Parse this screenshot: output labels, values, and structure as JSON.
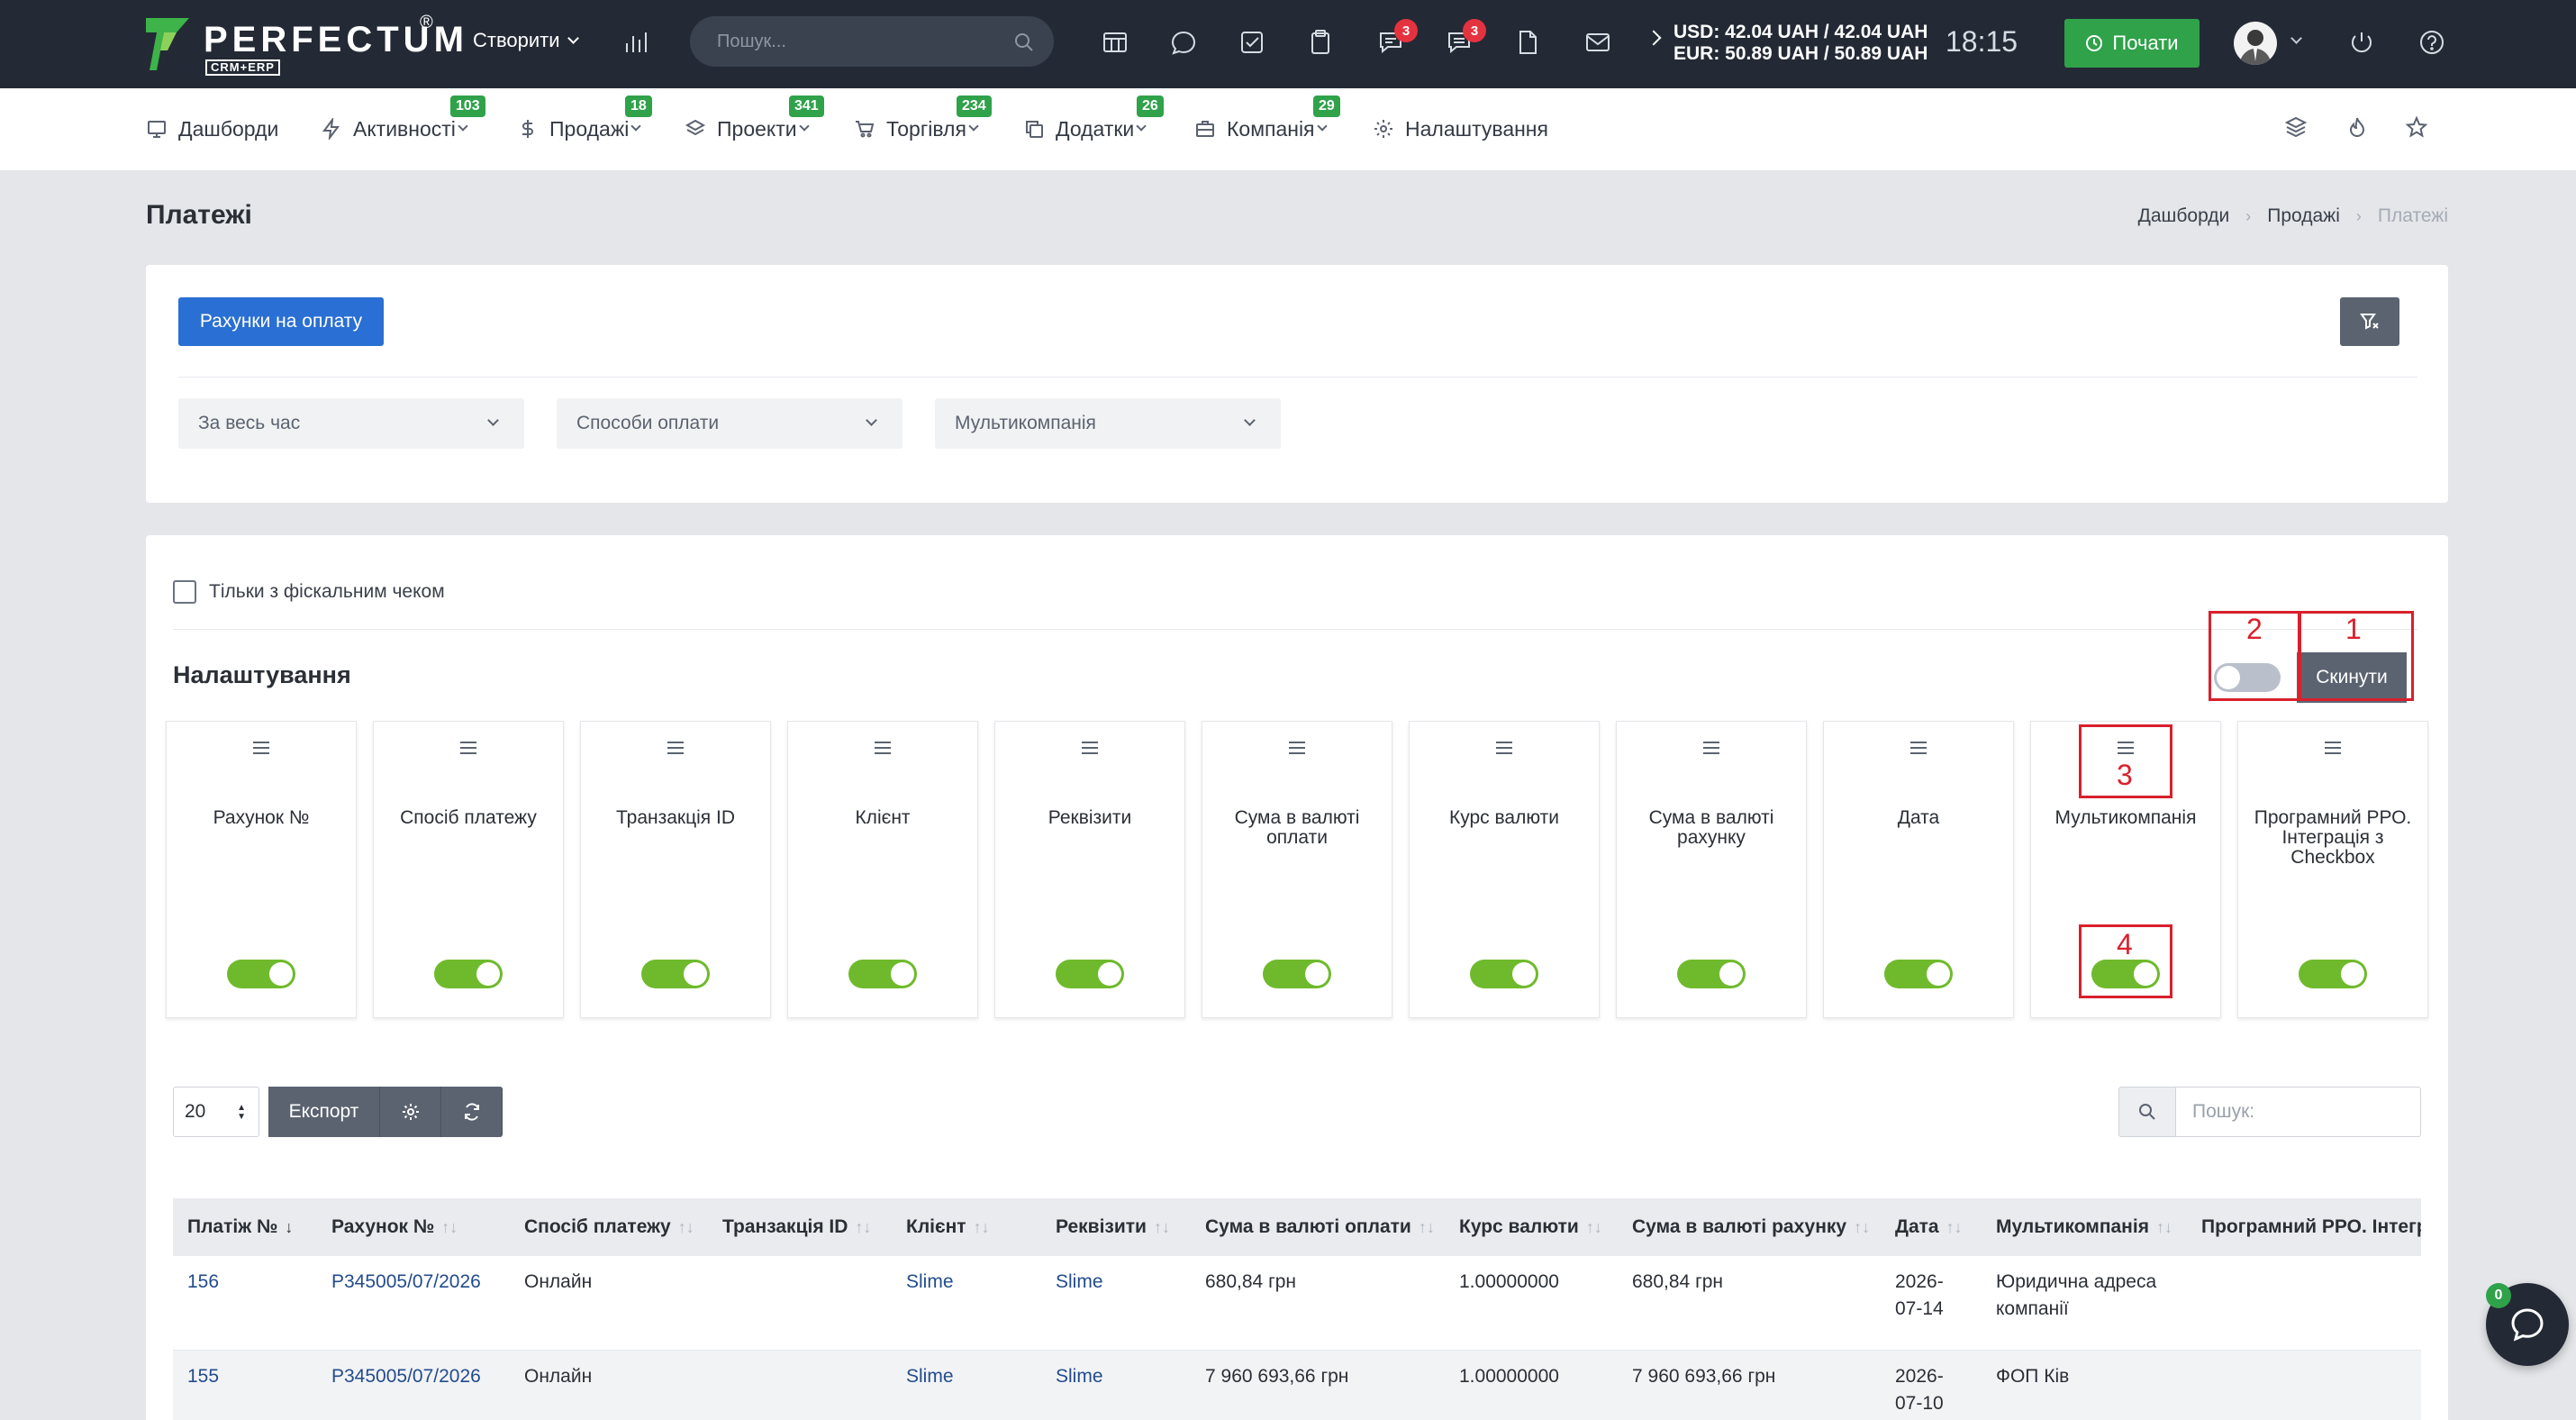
{
  "brand": {
    "name": "PERFECTUM",
    "sub": "CRM+ERP",
    "reg": "®"
  },
  "topbar": {
    "create_label": "Створити",
    "search_placeholder": "Пошук...",
    "notif_chat": "3",
    "notif_messages": "3",
    "currency_usd": "USD: 42.04 UAH / 42.04 UAH",
    "currency_eur": "EUR: 50.89 UAH / 50.89 UAH",
    "clock": "18:15",
    "start_label": "Почати",
    "colors": {
      "bg": "#232a35",
      "start": "#2fa24a",
      "badge": "#e5323f"
    }
  },
  "nav": {
    "items": [
      {
        "label": "Дашборди",
        "icon": "monitor-icon",
        "badge": ""
      },
      {
        "label": "Активності",
        "icon": "lightning-icon",
        "badge": "103"
      },
      {
        "label": "Продажі",
        "icon": "dollar-icon",
        "badge": "18"
      },
      {
        "label": "Проекти",
        "icon": "layers-icon",
        "badge": "341"
      },
      {
        "label": "Торгівля",
        "icon": "cart-icon",
        "badge": "234"
      },
      {
        "label": "Додатки",
        "icon": "copy-icon",
        "badge": "26"
      },
      {
        "label": "Компанія",
        "icon": "briefcase-icon",
        "badge": "29"
      },
      {
        "label": "Налаштування",
        "icon": "gear-icon",
        "badge": ""
      }
    ]
  },
  "page": {
    "title": "Платежі",
    "breadcrumb": [
      "Дашборди",
      "Продажі",
      "Платежі"
    ]
  },
  "filters": {
    "invoices_button": "Рахунки на оплату",
    "period": "За весь час",
    "payment_methods": "Способи оплати",
    "multicompany": "Мультикомпанія"
  },
  "settings": {
    "fiscal_only_label": "Тільки з фіскальним чеком",
    "title": "Налаштування",
    "reset_label": "Скинути",
    "annotations": [
      "1",
      "2",
      "3",
      "4"
    ],
    "columns": [
      "Рахунок №",
      "Спосіб платежу",
      "Транзакція ID",
      "Клієнт",
      "Реквізити",
      "Сума в валюті оплати",
      "Курс валюти",
      "Сума в валюті рахунку",
      "Дата",
      "Мультикомпанія",
      "Програмний РРО. Інтеграція з Checkbox"
    ],
    "all_toggle_on": false,
    "column_toggles_on": true
  },
  "table_toolbar": {
    "page_size": "20",
    "export_label": "Експорт",
    "search_placeholder": "Пошук:"
  },
  "table": {
    "headers": [
      "Платіж №",
      "Рахунок №",
      "Спосіб платежу",
      "Транзакція ID",
      "Клієнт",
      "Реквізити",
      "Сума в валюті оплати",
      "Курс валюти",
      "Сума в валюті рахунку",
      "Дата",
      "Мультикомпанія",
      "Програмний РРО. Інтеграція з Checkbox"
    ],
    "rows": [
      {
        "payment": "156",
        "invoice": "Р345005/07/2026",
        "method": "Онлайн",
        "transaction": "",
        "client": "Slime",
        "details": "Slime",
        "sum_pay": "680,84 грн",
        "rate": "1.00000000",
        "sum_invoice": "680,84 грн",
        "date": "2026-07-14",
        "multicompany": "Юридична адреса компанії",
        "rro": ""
      },
      {
        "payment": "155",
        "invoice": "Р345005/07/2026",
        "method": "Онлайн",
        "transaction": "",
        "client": "Slime",
        "details": "Slime",
        "sum_pay": "7 960 693,66 грн",
        "rate": "1.00000000",
        "sum_invoice": "7 960 693,66 грн",
        "date": "2026-07-10",
        "multicompany": "ФОП Ків",
        "rro": ""
      }
    ]
  },
  "chat": {
    "badge": "0"
  }
}
